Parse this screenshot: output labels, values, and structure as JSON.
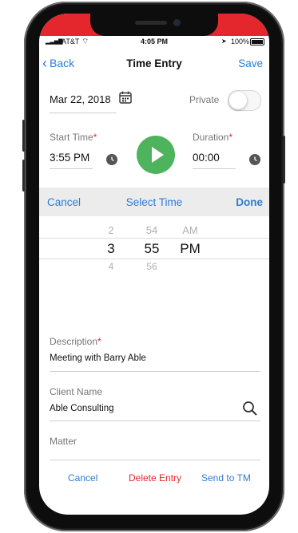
{
  "status_bar": {
    "carrier": "AT&T",
    "time": "4:05 PM",
    "battery": "100%"
  },
  "nav": {
    "back_label": "Back",
    "title": "Time Entry",
    "save_label": "Save"
  },
  "date": {
    "value": "Mar 22, 2018",
    "private_label": "Private",
    "private_on": false
  },
  "start_time": {
    "label": "Start Time",
    "required_mark": "*",
    "value": "3:55 PM"
  },
  "duration": {
    "label": "Duration",
    "required_mark": "*",
    "value": "00:00"
  },
  "picker_bar": {
    "cancel_label": "Cancel",
    "title": "Select Time",
    "done_label": "Done"
  },
  "time_picker": {
    "hours": [
      "2",
      "3",
      "4"
    ],
    "minutes": [
      "54",
      "55",
      "56"
    ],
    "periods": [
      "AM",
      "PM"
    ],
    "selected": {
      "hour": "3",
      "minute": "55",
      "period": "PM"
    }
  },
  "description": {
    "label": "Description",
    "required_mark": "*",
    "value": "Meeting with Barry Able"
  },
  "client": {
    "label": "Client Name",
    "value": "Able Consulting"
  },
  "matter": {
    "label": "Matter",
    "value": ""
  },
  "actions": {
    "cancel_label": "Cancel",
    "delete_label": "Delete Entry",
    "send_label": "Send to TM"
  },
  "colors": {
    "accent": "#2f7bd3",
    "brand_red": "#e4272d",
    "play_green": "#4db35c"
  }
}
